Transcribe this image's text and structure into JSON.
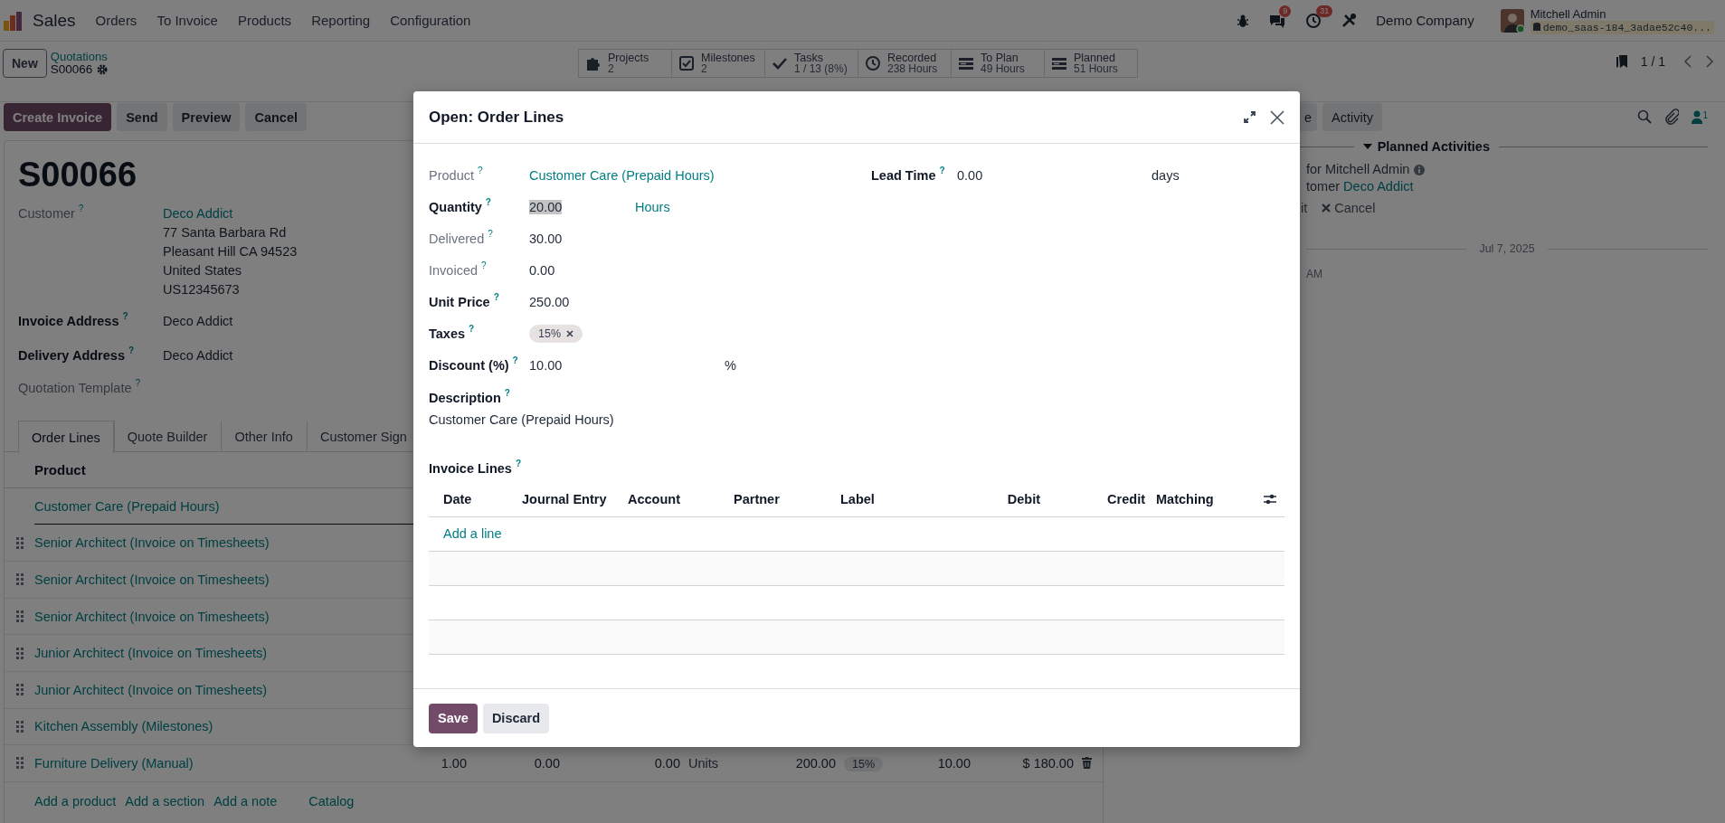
{
  "navbar": {
    "app": "Sales",
    "menu": [
      "Orders",
      "To Invoice",
      "Products",
      "Reporting",
      "Configuration"
    ],
    "messages_badge": "9",
    "activities_badge": "31",
    "company": "Demo Company",
    "user": "Mitchell Admin",
    "database": "demo_saas-184_3adae52c40..."
  },
  "control_panel": {
    "new_button": "New",
    "breadcrumb": "Quotations",
    "record": "S00066",
    "smart_buttons": [
      {
        "kind": "projects",
        "label": "Projects",
        "value": "2"
      },
      {
        "kind": "milestones",
        "label": "Milestones",
        "value": "2"
      },
      {
        "kind": "tasks",
        "label": "Tasks",
        "value": "1 / 13 (8%)"
      },
      {
        "kind": "recorded",
        "label": "Recorded",
        "value": "238 Hours"
      },
      {
        "kind": "planning",
        "label": "To Plan",
        "value": "49 Hours"
      },
      {
        "kind": "planning",
        "label": "Planned",
        "value": "51 Hours"
      }
    ],
    "pager": "1 / 1"
  },
  "action_buttons": [
    {
      "label": "Create Invoice",
      "kind": "primary"
    },
    {
      "label": "Send",
      "kind": "secondary"
    },
    {
      "label": "Preview",
      "kind": "secondary"
    },
    {
      "label": "Cancel",
      "kind": "secondary"
    }
  ],
  "form": {
    "title": "S00066",
    "fields": [
      {
        "label": "Customer",
        "help": "?",
        "required": false,
        "link": "Deco Addict",
        "lines": [
          "77 Santa Barbara Rd",
          "Pleasant Hill CA 94523",
          "United States",
          "US12345673"
        ]
      },
      {
        "label": "Invoice Address",
        "help": "?",
        "required": true,
        "value": "Deco Addict"
      },
      {
        "label": "Delivery Address",
        "help": "?",
        "required": true,
        "value": "Deco Addict"
      },
      {
        "label": "Quotation Template",
        "help": "?",
        "required": false
      }
    ],
    "tabs": [
      {
        "label": "Order Lines",
        "selected": true
      },
      {
        "label": "Quote Builder",
        "selected": false
      },
      {
        "label": "Other Info",
        "selected": false
      },
      {
        "label": "Customer Sign",
        "selected": false
      }
    ],
    "order_lines": {
      "column": "Product",
      "rows": [
        {
          "product": "Customer Care (Prepaid Hours)",
          "handle": false,
          "editing": true
        },
        {
          "product": "Senior Architect (Invoice on Timesheets)",
          "handle": true,
          "editing": false
        },
        {
          "product": "Senior Architect (Invoice on Timesheets)",
          "handle": true,
          "editing": false
        },
        {
          "product": "Senior Architect (Invoice on Timesheets)",
          "handle": true,
          "editing": false
        },
        {
          "product": "Junior Architect (Invoice on Timesheets)",
          "handle": true,
          "editing": false
        },
        {
          "product": "Junior Architect (Invoice on Timesheets)",
          "handle": true,
          "editing": false
        },
        {
          "product": "Kitchen Assembly (Milestones)",
          "handle": true,
          "editing": false
        },
        {
          "product": "Furniture Delivery (Manual)",
          "handle": true,
          "editing": false,
          "quantity": "1.00",
          "delivered": "0.00",
          "invoiced": "0.00",
          "unit": "Units",
          "unit_price": "200.00",
          "tax": "15%",
          "discount": "10.00",
          "subtotal": "$ 180.00"
        }
      ],
      "footer_links": [
        {
          "label": "Add a product",
          "kind": "add"
        },
        {
          "label": "Add a section",
          "kind": "add"
        },
        {
          "label": "Add a note",
          "kind": "add"
        },
        {
          "label": "Catalog",
          "kind": "catalog"
        }
      ]
    }
  },
  "chatter": {
    "buttons": [
      "e",
      "Activity"
    ],
    "followers": "1",
    "section": "Planned Activities",
    "activity_summary": "for Mitchell Admin",
    "activity_customer_prefix": "tomer ",
    "activity_customer": "Deco Addict",
    "activity_actions": [
      {
        "label": "it",
        "icon": false
      },
      {
        "label": "Cancel",
        "icon": true
      }
    ],
    "date": "Jul 7, 2025",
    "message_time": "AM"
  },
  "dialog": {
    "title": "Open: Order Lines",
    "fields": [
      {
        "label": "Product",
        "help": "?",
        "required": false,
        "kind": "link",
        "value": "Customer Care (Prepaid Hours)",
        "highlighted": false
      },
      {
        "label": "Quantity",
        "help": "?",
        "required": true,
        "kind": "quantity",
        "value": "20.00",
        "unit": "Hours",
        "highlighted": true
      },
      {
        "label": "Delivered",
        "help": "?",
        "required": false,
        "kind": "text",
        "value": "30.00",
        "highlighted": false
      },
      {
        "label": "Invoiced",
        "help": "?",
        "required": false,
        "kind": "text",
        "value": "0.00",
        "highlighted": false
      },
      {
        "label": "Unit Price",
        "help": "?",
        "required": true,
        "kind": "text",
        "value": "250.00",
        "highlighted": false
      },
      {
        "label": "Taxes",
        "help": "?",
        "required": true,
        "kind": "tags",
        "tags": [
          "15%"
        ],
        "highlighted": false
      },
      {
        "label": "Discount (%)",
        "help": "?",
        "required": true,
        "kind": "percent",
        "value": "10.00",
        "unit": "%",
        "highlighted": false
      }
    ],
    "side_fields": [
      {
        "label": "Lead Time",
        "help": "?",
        "required": true,
        "kind": "days",
        "value": "0.00",
        "unit": "days",
        "highlighted": false
      }
    ],
    "description": {
      "label": "Description",
      "help": "?",
      "value": "Customer Care (Prepaid Hours)"
    },
    "invoice_lines": {
      "label": "Invoice Lines",
      "help": "?",
      "columns": [
        {
          "label": "Date",
          "kind": "text"
        },
        {
          "label": "Journal Entry",
          "kind": "text"
        },
        {
          "label": "Account",
          "kind": "text"
        },
        {
          "label": "Partner",
          "kind": "text"
        },
        {
          "label": "Label",
          "kind": "text"
        },
        {
          "label": "Debit",
          "kind": "number"
        },
        {
          "label": "Credit",
          "kind": "number"
        },
        {
          "label": "Matching",
          "kind": "text"
        }
      ],
      "add_line": "Add a line"
    },
    "buttons": [
      {
        "label": "Save",
        "kind": "primary"
      },
      {
        "label": "Discard",
        "kind": "secondary"
      }
    ]
  }
}
